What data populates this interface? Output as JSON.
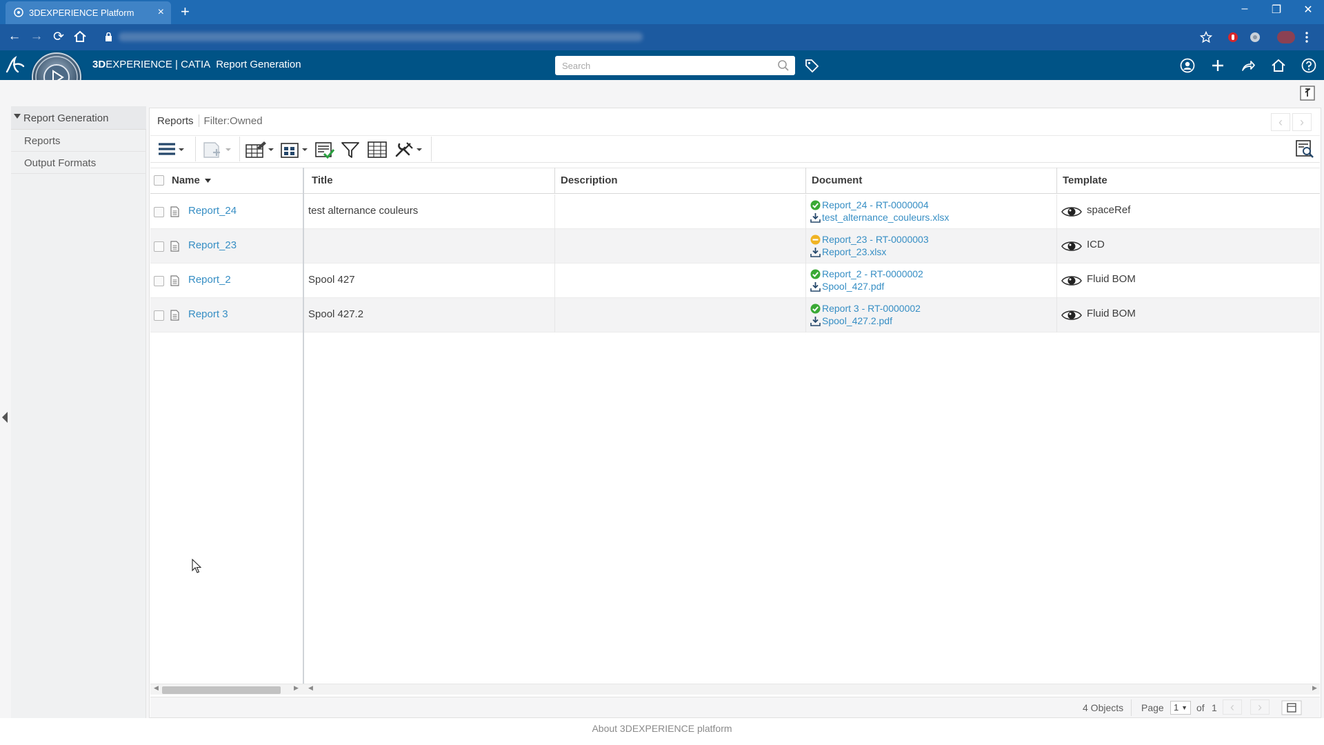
{
  "browser": {
    "tab_title": "3DEXPERIENCE Platform",
    "tab_close": "×",
    "new_tab": "+",
    "minimize": "–",
    "restore": "❐",
    "close": "✕",
    "back": "←",
    "forward": "→",
    "reload": "⟳"
  },
  "header": {
    "brand_prefix": "3D",
    "brand_rest": "EXPERIENCE | CATIA",
    "app_name": "Report Generation",
    "search_placeholder": "Search"
  },
  "sidebar": {
    "root": "Report Generation",
    "items": [
      "Reports",
      "Output Formats"
    ]
  },
  "breadcrumb": {
    "title": "Reports",
    "filter": "Filter:Owned"
  },
  "table": {
    "columns": {
      "name": "Name",
      "title": "Title",
      "description": "Description",
      "document": "Document",
      "template": "Template"
    },
    "rows": [
      {
        "name": "Report_24",
        "title": "test alternance couleurs",
        "description": "",
        "doc_ref": "Report_24 - RT-0000004",
        "doc_file": "test_alternance_couleurs.xlsx",
        "status": "ok",
        "template": "spaceRef"
      },
      {
        "name": "Report_23",
        "title": "",
        "description": "",
        "doc_ref": "Report_23 - RT-0000003",
        "doc_file": "Report_23.xlsx",
        "status": "pending",
        "template": "ICD"
      },
      {
        "name": "Report_2",
        "title": "Spool 427",
        "description": "",
        "doc_ref": "Report_2 - RT-0000002",
        "doc_file": "Spool_427.pdf",
        "status": "ok",
        "template": "Fluid BOM"
      },
      {
        "name": "Report 3",
        "title": "Spool 427.2",
        "description": "",
        "doc_ref": "Report 3 - RT-0000002",
        "doc_file": "Spool_427.2.pdf",
        "status": "ok",
        "template": "Fluid BOM"
      }
    ]
  },
  "status": {
    "count": "4 Objects",
    "page_label": "Page",
    "page_value": "1",
    "of_label": "of",
    "total_pages": "1"
  },
  "footer": {
    "about": "About 3DEXPERIENCE platform"
  },
  "colors": {
    "browser_blue": "#1f6bb4",
    "app_header": "#005386",
    "link": "#368ec4",
    "status_ok": "#3aa935",
    "status_pending": "#f0b323"
  }
}
